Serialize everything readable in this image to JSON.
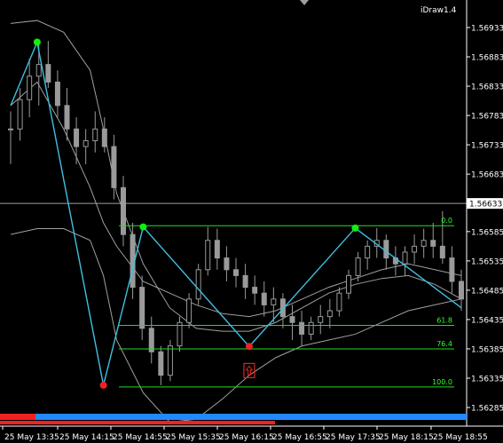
{
  "indicator_label": "iDraw1.4",
  "current_price": "1.56633",
  "price_axis": [
    {
      "label": "1.56933",
      "price": 1.56933
    },
    {
      "label": "1.56883",
      "price": 1.56883
    },
    {
      "label": "1.56833",
      "price": 1.56833
    },
    {
      "label": "1.56783",
      "price": 1.56783
    },
    {
      "label": "1.56733",
      "price": 1.56733
    },
    {
      "label": "1.56683",
      "price": 1.56683
    },
    {
      "label": "1.56585",
      "price": 1.56585
    },
    {
      "label": "1.56535",
      "price": 1.56535
    },
    {
      "label": "1.56485",
      "price": 1.56485
    },
    {
      "label": "1.56435",
      "price": 1.56435
    },
    {
      "label": "1.56385",
      "price": 1.56385
    },
    {
      "label": "1.56335",
      "price": 1.56335
    },
    {
      "label": "1.56285",
      "price": 1.56285
    }
  ],
  "time_axis": [
    "25 May 13:35",
    "25 May 14:15",
    "25 May 14:55",
    "25 May 15:35",
    "25 May 16:15",
    "25 May 16:55",
    "25 May 17:35",
    "25 May 18:15",
    "25 May 18:55"
  ],
  "fibonacci": [
    {
      "label": "0.0",
      "price": 1.56595
    },
    {
      "label": "61.8",
      "price": 1.56425
    },
    {
      "label": "76.4",
      "price": 1.56385
    },
    {
      "label": "100.0",
      "price": 1.5632
    }
  ],
  "zigzag_points": [
    {
      "time": "25 May 13:15",
      "price": 1.568
    },
    {
      "time": "25 May 13:35",
      "price": 1.56908,
      "marker": "green"
    },
    {
      "time": "25 May 14:25",
      "price": 1.56323,
      "marker": "red"
    },
    {
      "time": "25 May 14:55",
      "price": 1.56593,
      "marker": "green"
    },
    {
      "time": "25 May 16:15",
      "price": 1.56389,
      "marker": "red"
    },
    {
      "time": "25 May 17:35",
      "price": 1.56591,
      "marker": "green"
    },
    {
      "time": "25 May 18:55",
      "price": 1.56455
    }
  ],
  "buy_signal": {
    "icon": "up-arrow-signal-icon",
    "time": "25 May 16:15",
    "price": 1.56348
  },
  "colors": {
    "background": "#000000",
    "zigzag": "#40c0e0",
    "fib_levels": "#22dd22",
    "envelope": "#a0a0a0",
    "candles": "#9a9a9a",
    "current_price_line": "#9aa0a8",
    "swing_high_dot": "#11ee11",
    "swing_low_dot": "#ee2222",
    "buy_signal": "#dd2222",
    "bottom_bar_red": "#ee2222",
    "bottom_bar_blue": "#2288ff"
  },
  "chart_data": {
    "type": "line",
    "x": [
      "25 May 13:15",
      "25 May 13:35",
      "25 May 13:55",
      "25 May 14:15",
      "25 May 14:25",
      "25 May 14:35",
      "25 May 14:55",
      "25 May 15:15",
      "25 May 15:35",
      "25 May 15:55",
      "25 May 16:15",
      "25 May 16:35",
      "25 May 16:55",
      "25 May 17:15",
      "25 May 17:35",
      "25 May 17:55",
      "25 May 18:15",
      "25 May 18:35",
      "25 May 18:55"
    ],
    "series": [
      {
        "values": [
          1.5694,
          1.56945,
          1.56925,
          1.5686,
          1.5676,
          1.5665,
          1.5653,
          1.56455,
          1.5642,
          1.56415,
          1.56415,
          1.5643,
          1.56455,
          1.5648,
          1.56495,
          1.56505,
          1.5651,
          1.56495,
          1.5647
        ]
      },
      {
        "values": [
          1.568,
          1.5684,
          1.5676,
          1.5666,
          1.566,
          1.5656,
          1.565,
          1.5648,
          1.5646,
          1.56445,
          1.5644,
          1.5645,
          1.5647,
          1.5649,
          1.56505,
          1.5652,
          1.5653,
          1.5652,
          1.5651
        ]
      },
      {
        "values": [
          1.5658,
          1.5659,
          1.5659,
          1.5657,
          1.5651,
          1.564,
          1.5631,
          1.5626,
          1.56265,
          1.563,
          1.5634,
          1.5637,
          1.5639,
          1.564,
          1.5641,
          1.5643,
          1.5645,
          1.5646,
          1.5647
        ]
      }
    ],
    "candles": [
      [
        1.5676,
        1.5679,
        1.567,
        1.5676
      ],
      [
        1.5676,
        1.5683,
        1.5674,
        1.5681
      ],
      [
        1.5681,
        1.5688,
        1.5678,
        1.5685
      ],
      [
        1.5685,
        1.56905,
        1.568,
        1.5687
      ],
      [
        1.5687,
        1.5691,
        1.5683,
        1.5684
      ],
      [
        1.5684,
        1.5686,
        1.5678,
        1.568
      ],
      [
        1.568,
        1.5683,
        1.5674,
        1.5676
      ],
      [
        1.5676,
        1.5678,
        1.567,
        1.5673
      ],
      [
        1.5673,
        1.5676,
        1.567,
        1.5674
      ],
      [
        1.5674,
        1.5679,
        1.5672,
        1.5676
      ],
      [
        1.5676,
        1.5678,
        1.5672,
        1.5673
      ],
      [
        1.5673,
        1.5675,
        1.5664,
        1.5666
      ],
      [
        1.5666,
        1.5668,
        1.5656,
        1.5658
      ],
      [
        1.5658,
        1.566,
        1.5647,
        1.5649
      ],
      [
        1.5649,
        1.5651,
        1.564,
        1.5642
      ],
      [
        1.5642,
        1.5644,
        1.5636,
        1.5638
      ],
      [
        1.5638,
        1.5639,
        1.56323,
        1.5634
      ],
      [
        1.5634,
        1.564,
        1.5633,
        1.5639
      ],
      [
        1.5639,
        1.5644,
        1.5638,
        1.5643
      ],
      [
        1.5643,
        1.5648,
        1.5642,
        1.5647
      ],
      [
        1.5647,
        1.5653,
        1.5646,
        1.5652
      ],
      [
        1.5652,
        1.56593,
        1.5651,
        1.5657
      ],
      [
        1.5657,
        1.5659,
        1.5652,
        1.5654
      ],
      [
        1.5654,
        1.5656,
        1.565,
        1.5652
      ],
      [
        1.5652,
        1.5654,
        1.5649,
        1.5651
      ],
      [
        1.5651,
        1.5653,
        1.5647,
        1.5649
      ],
      [
        1.5649,
        1.5651,
        1.5646,
        1.5648
      ],
      [
        1.5648,
        1.565,
        1.5644,
        1.5646
      ],
      [
        1.5646,
        1.5649,
        1.5643,
        1.5647
      ],
      [
        1.5647,
        1.5648,
        1.5642,
        1.5644
      ],
      [
        1.5644,
        1.5646,
        1.564,
        1.5643
      ],
      [
        1.5643,
        1.5645,
        1.56389,
        1.5641
      ],
      [
        1.5641,
        1.5644,
        1.564,
        1.5643
      ],
      [
        1.5643,
        1.5646,
        1.5641,
        1.5644
      ],
      [
        1.5644,
        1.5647,
        1.5642,
        1.5645
      ],
      [
        1.5645,
        1.5649,
        1.5644,
        1.5648
      ],
      [
        1.5648,
        1.5652,
        1.5647,
        1.5651
      ],
      [
        1.5651,
        1.5655,
        1.565,
        1.5654
      ],
      [
        1.5654,
        1.5657,
        1.5652,
        1.5656
      ],
      [
        1.5656,
        1.56591,
        1.5654,
        1.5657
      ],
      [
        1.5657,
        1.5658,
        1.5652,
        1.5654
      ],
      [
        1.5654,
        1.5656,
        1.5651,
        1.5653
      ],
      [
        1.5653,
        1.5656,
        1.5651,
        1.5655
      ],
      [
        1.5655,
        1.5658,
        1.5653,
        1.5656
      ],
      [
        1.5656,
        1.5659,
        1.5654,
        1.5657
      ],
      [
        1.5657,
        1.566,
        1.5654,
        1.5656
      ],
      [
        1.5656,
        1.5662,
        1.5653,
        1.5654
      ],
      [
        1.5654,
        1.5656,
        1.5648,
        1.565
      ],
      [
        1.565,
        1.5652,
        1.5645,
        1.5647
      ]
    ],
    "ylim": [
      1.56275,
      1.56975
    ],
    "xlim": [
      "25 May 13:15",
      "25 May 18:55"
    ]
  }
}
